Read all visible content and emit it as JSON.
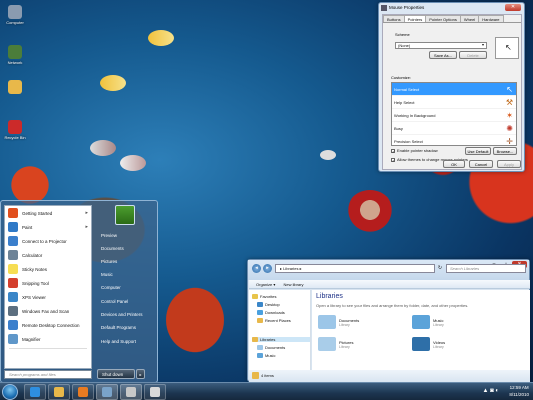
{
  "desktop": {
    "icons": [
      {
        "label": "Computer",
        "color": "#8a9bb0"
      },
      {
        "label": "Network",
        "color": "#4b7d3a"
      },
      {
        "label": "",
        "color": "#e8b84a"
      },
      {
        "label": "Recycle Bin",
        "color": "#cc2a2a"
      }
    ]
  },
  "start_menu": {
    "left_items": [
      {
        "label": "Getting Started",
        "icon_color": "#e14f1d",
        "has_arrow": true
      },
      {
        "label": "Paint",
        "icon_color": "#2f79c7",
        "has_arrow": true
      },
      {
        "label": "Connect to a Projector",
        "icon_color": "#3b7fcc",
        "has_arrow": false
      },
      {
        "label": "Calculator",
        "icon_color": "#6d8397",
        "has_arrow": false
      },
      {
        "label": "Sticky Notes",
        "icon_color": "#f6dd53",
        "has_arrow": false
      },
      {
        "label": "Snipping Tool",
        "icon_color": "#d43f2d",
        "has_arrow": false
      },
      {
        "label": "XPS Viewer",
        "icon_color": "#3a86c8",
        "has_arrow": false
      },
      {
        "label": "Windows Fax and Scan",
        "icon_color": "#5c6f80",
        "has_arrow": false
      },
      {
        "label": "Remote Desktop Connection",
        "icon_color": "#3b7fcc",
        "has_arrow": false
      },
      {
        "label": "Magnifier",
        "icon_color": "#5f97c9",
        "has_arrow": false
      }
    ],
    "all_programs": "All Programs",
    "search_placeholder": "Search programs and files",
    "right_items": [
      "Preview",
      "Documents",
      "Pictures",
      "Music",
      "Computer",
      "Control Panel",
      "Devices and Printers",
      "Default Programs",
      "Help and Support"
    ],
    "shutdown_label": "Shut down",
    "shutdown_arrow": "▸"
  },
  "taskbar": {
    "apps": [
      {
        "name": "ie",
        "color": "#2e8fe0"
      },
      {
        "name": "explorer",
        "color": "#e8b84a"
      },
      {
        "name": "media-player",
        "color": "#e87b22"
      },
      {
        "name": "control",
        "color": "#7aa3c9"
      },
      {
        "name": "mouse",
        "color": "#c8c8c8"
      },
      {
        "name": "paint",
        "color": "#d9d9d9"
      }
    ],
    "tray_icons": "▲ ◙ ◐",
    "time": "12:59 AM",
    "date": "8/11/2010"
  },
  "mouse_dialog": {
    "title": "Mouse Properties",
    "close": "✕",
    "tabs": [
      "Buttons",
      "Pointers",
      "Pointer Options",
      "Wheel",
      "Hardware"
    ],
    "active_tab": 1,
    "scheme_label": "Scheme",
    "scheme_value": "(None)",
    "save_as": "Save As...",
    "delete": "Delete",
    "preview_cursor": "↖",
    "customize_label": "Customize:",
    "cursors": [
      {
        "name": "Normal Select",
        "glyph": "↖",
        "selected": true
      },
      {
        "name": "Help Select",
        "glyph": "⚒",
        "selected": false
      },
      {
        "name": "Working In Background",
        "glyph": "✶",
        "selected": false
      },
      {
        "name": "Busy",
        "glyph": "✺",
        "selected": false
      },
      {
        "name": "Precision Select",
        "glyph": "✛",
        "selected": false
      }
    ],
    "enable_shadow": "Enable pointer shadow",
    "use_default": "Use Default",
    "browse": "Browse...",
    "allow_themes": "Allow themes to change mouse pointers",
    "ok": "OK",
    "cancel": "Cancel",
    "apply": "Apply"
  },
  "explorer": {
    "back": "◂",
    "forward": "▸",
    "address": "▸ Libraries ▸",
    "refresh": "↻",
    "search_placeholder": "Search Libraries",
    "organize": "Organize ▾",
    "new_library": "New library",
    "nav": {
      "favorites": "Favorites",
      "desktop": "Desktop",
      "downloads": "Downloads",
      "recent": "Recent Places",
      "libraries": "Libraries",
      "documents": "Documents",
      "music": "Music"
    },
    "title": "Libraries",
    "subtitle": "Open a library to see your files and arrange them by folder, date, and other properties.",
    "libraries": [
      {
        "name": "Documents",
        "sub": "Library",
        "color": "#9cc6e8"
      },
      {
        "name": "Music",
        "sub": "Library",
        "color": "#5ba3d9"
      },
      {
        "name": "Pictures",
        "sub": "Library",
        "color": "#a9cde9"
      },
      {
        "name": "Videos",
        "sub": "Library",
        "color": "#2e6fa8"
      }
    ],
    "status": "4 items"
  }
}
